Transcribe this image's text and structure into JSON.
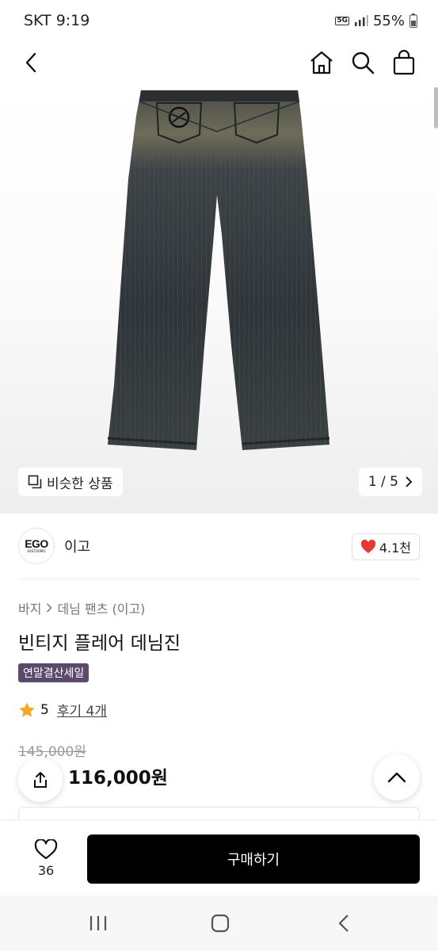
{
  "status_bar": {
    "carrier_time": "SKT 9:19",
    "network": "5G",
    "battery": "55%"
  },
  "gallery": {
    "similar_label": "비슷한 상품",
    "page_indicator": "1 / 5"
  },
  "brand": {
    "logo_text": "EGO",
    "logo_subtext": "EASTOOMG",
    "name": "이고",
    "likes": "4.1천"
  },
  "product": {
    "breadcrumb": [
      "바지",
      "데님 팬츠 (이고)"
    ],
    "title": "빈티지 플레어 데님진",
    "badge": "연말결산세일",
    "rating": "5",
    "reviews": "후기 4개",
    "original_price": "145,000원",
    "price": "116,000원"
  },
  "action_bar": {
    "wish_count": "36",
    "buy_label": "구매하기"
  },
  "colors": {
    "accent": "#000000",
    "badge": "#5b4a6b",
    "heart": "#e53935",
    "star": "#f5a623"
  }
}
